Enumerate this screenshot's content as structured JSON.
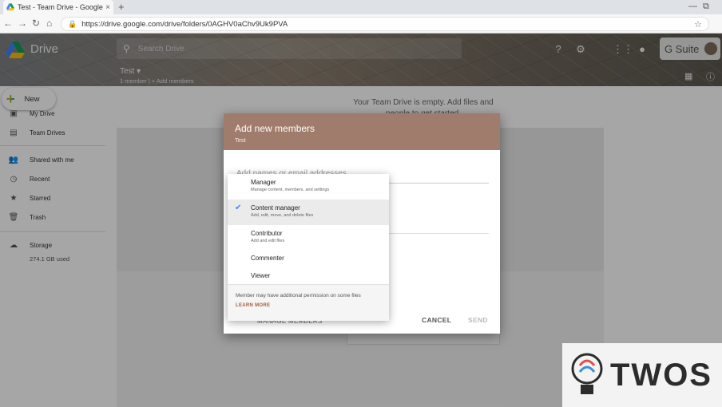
{
  "browser": {
    "tab_title": "Test - Team Drive - Google Drive",
    "tab_close": "×",
    "new_tab": "+",
    "url": "https://drive.google.com/drive/folders/0AGHV0aChv9Uk9PVA"
  },
  "header": {
    "app_name": "Drive",
    "search_placeholder": "Search Drive",
    "brand_badge": "G Suite",
    "folder_title": "Test ▾",
    "folder_sub": "1 member  |  + Add members"
  },
  "sidebar": {
    "new_label": "New",
    "items": [
      {
        "label": "My Drive",
        "icon": "my-drive-icon"
      },
      {
        "label": "Team Drives",
        "icon": "team-drives-icon"
      },
      {
        "label": "Shared with me",
        "icon": "people-icon"
      },
      {
        "label": "Recent",
        "icon": "clock-icon"
      },
      {
        "label": "Starred",
        "icon": "star-icon"
      },
      {
        "label": "Trash",
        "icon": "trash-icon"
      },
      {
        "label": "Storage",
        "icon": "cloud-icon"
      }
    ],
    "storage_used": "274.1 GB used"
  },
  "main": {
    "empty_message": "Your Team Drive is empty. Add files and people to get started."
  },
  "dialog": {
    "title": "Add new members",
    "subtitle": "Test",
    "input_placeholder": "Add names or email addresses",
    "manage_members": "MANAGE MEMBERS",
    "cancel": "CANCEL",
    "send": "SEND"
  },
  "role_menu": {
    "roles": [
      {
        "name": "Manager",
        "desc": "Manage content, members, and settings",
        "selected": false
      },
      {
        "name": "Content manager",
        "desc": "Add, edit, move, and delete files",
        "selected": true
      },
      {
        "name": "Contributor",
        "desc": "Add and edit files",
        "selected": false
      },
      {
        "name": "Commenter",
        "desc": "",
        "selected": false
      },
      {
        "name": "Viewer",
        "desc": "",
        "selected": false
      }
    ],
    "note": "Member may have additional permission on some files",
    "learn_more": "LEARN MORE"
  },
  "watermark": {
    "text": "TWOS"
  },
  "colors": {
    "dialog_header": "#a07c6c",
    "check": "#4285f4",
    "learn_more": "#a06040"
  }
}
